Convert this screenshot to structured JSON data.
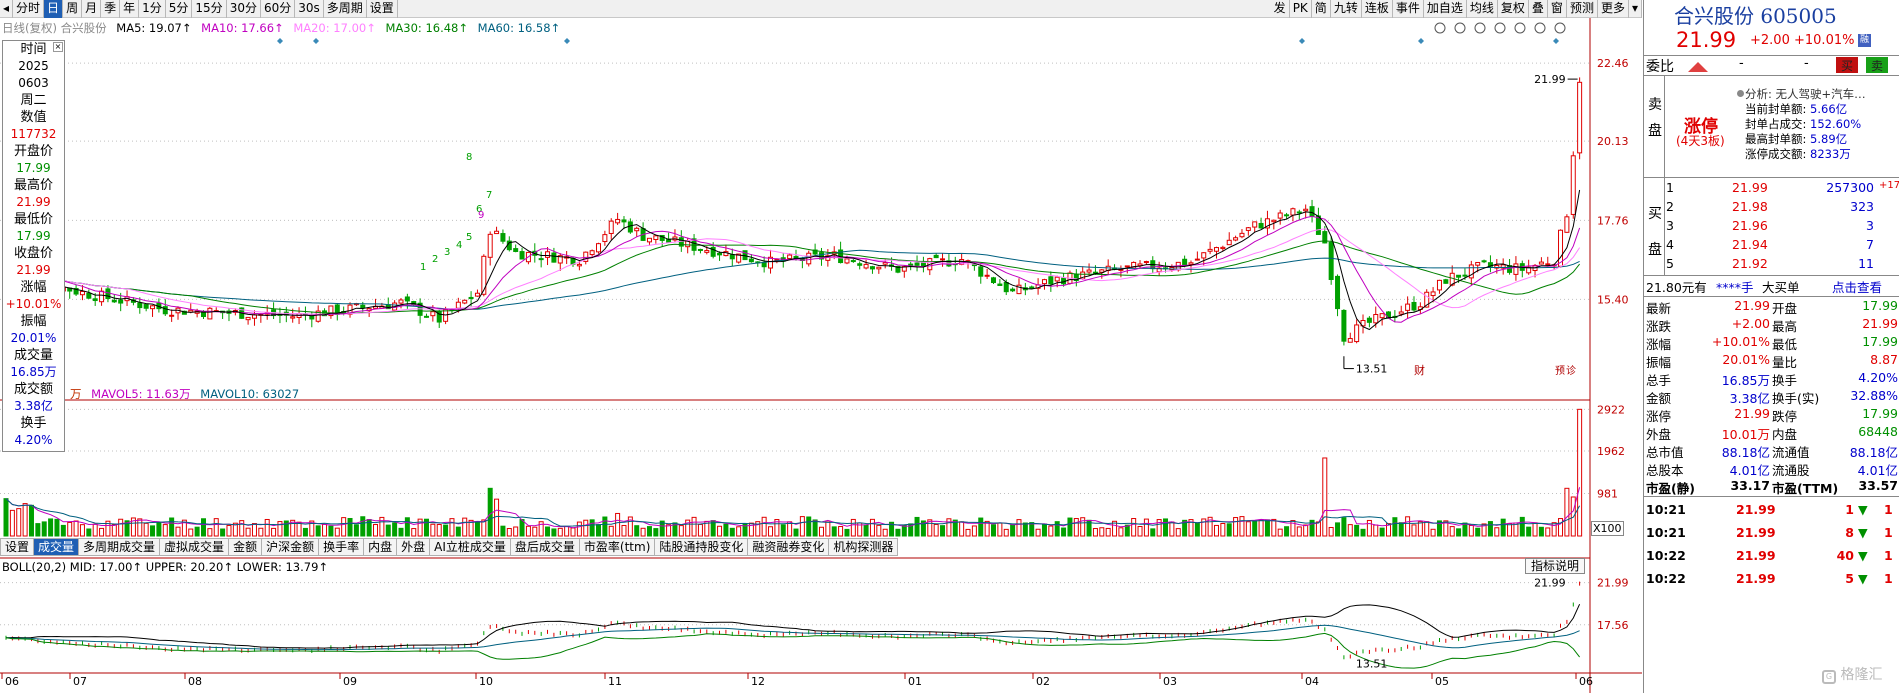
{
  "toolbar": {
    "left": [
      "分时",
      "日",
      "周",
      "月",
      "季",
      "年",
      "1分",
      "5分",
      "15分",
      "30分",
      "60分",
      "30s",
      "多周期",
      "设置"
    ],
    "active": "日",
    "right": [
      "发",
      "PK",
      "简",
      "九转",
      "连板",
      "事件",
      "加自选",
      "均线",
      "复权",
      "叠",
      "窗",
      "预测",
      "更多"
    ]
  },
  "legend_price": {
    "prefix": "日线(复权)  合兴股份",
    "ma5": "MA5: 19.07↑",
    "ma10": "MA10: 17.66↑",
    "ma20": "MA20: 17.00↑",
    "ma30": "MA30: 16.48↑",
    "ma60": "MA60: 16.58↑",
    "colors": {
      "ma5": "#000000",
      "ma10": "#c000c0",
      "ma20": "#ff80ff",
      "ma30": "#008000",
      "ma60": "#006080"
    }
  },
  "legend_vol": {
    "unit": "万",
    "mavol5": "MAVOL5: 11.63万",
    "mavol10": "MAVOL10: 63027"
  },
  "legend_boll": "BOLL(20,2) MID: 17.00↑ UPPER: 20.20↑ LOWER: 13.79↑",
  "popup": {
    "labels": [
      "时间",
      "数值",
      "开盘价",
      "最高价",
      "最低价",
      "收盘价",
      "涨幅",
      "振幅",
      "成交量",
      "成交额",
      "换手"
    ],
    "time_year": "2025",
    "time_md": "0603",
    "time_wd": "周二",
    "value": "117732",
    "open": "17.99",
    "high": "21.99",
    "low": "17.99",
    "close": "21.99",
    "change": "+10.01%",
    "amplitude": "20.01%",
    "volume": "16.85万",
    "amount": "3.38亿",
    "turnover": "4.20%"
  },
  "price_axis": [
    "22.46",
    "20.13",
    "17.76",
    "15.40"
  ],
  "vol_axis": [
    "2922",
    "1962",
    "981"
  ],
  "boll_axis": [
    "21.99",
    "17.56"
  ],
  "annotations": {
    "high": "21.99",
    "low": "13.51",
    "boll_high": "21.99",
    "boll_low": "13.51"
  },
  "x_axis": [
    "06",
    "07",
    "08",
    "09",
    "10",
    "11",
    "12",
    "01",
    "02",
    "03",
    "04",
    "05",
    "06"
  ],
  "markers": {
    "cai": "财",
    "yu": "预",
    "zhen": "诊"
  },
  "td_labels": [
    {
      "t": "1",
      "c": "g"
    },
    {
      "t": "2",
      "c": "g"
    },
    {
      "t": "3",
      "c": "g"
    },
    {
      "t": "4",
      "c": "g"
    },
    {
      "t": "5",
      "c": "g"
    },
    {
      "t": "6",
      "c": "g"
    },
    {
      "t": "7",
      "c": "g"
    },
    {
      "t": "8",
      "c": "g"
    },
    {
      "t": "9",
      "c": "m"
    }
  ],
  "x100": "X100",
  "boll_help": "指标说明",
  "indicator_tabs": [
    "设置",
    "成交量",
    "多周期成交量",
    "虚拟成交量",
    "金额",
    "沪深金额",
    "换手率",
    "内盘",
    "外盘",
    "AI立桩成交量",
    "盘后成交量",
    "市盈率(ttm)",
    "陆股通持股变化",
    "融资融券变化",
    "机构探测器"
  ],
  "indicator_active": "成交量",
  "stock": {
    "name": "合兴股份",
    "code": "605005",
    "price": "21.99",
    "change": "+2.00",
    "pct": "+10.01%",
    "hk_badge": "融"
  },
  "weibi": {
    "label": "委比",
    "v1": "-",
    "v2": "-",
    "sell_btn": "买",
    "buy_btn": "卖"
  },
  "limit": {
    "sell_label": "卖盘",
    "title": "涨停",
    "sub": "(4天3板)",
    "analysis": "分析: 无人驾驶+汽车…",
    "items": [
      {
        "k": "当前封单额:",
        "v": "5.66亿"
      },
      {
        "k": "封单占成交:",
        "v": "152.60%"
      },
      {
        "k": "最高封单额:",
        "v": "5.89亿"
      },
      {
        "k": "涨停成交额:",
        "v": "8233万"
      }
    ]
  },
  "bids": {
    "label": "买盘",
    "rows": [
      {
        "lv": "1",
        "p": "21.99",
        "v": "257300",
        "d": "+17"
      },
      {
        "lv": "2",
        "p": "21.98",
        "v": "323",
        "d": ""
      },
      {
        "lv": "3",
        "p": "21.96",
        "v": "3",
        "d": ""
      },
      {
        "lv": "4",
        "p": "21.94",
        "v": "7",
        "d": ""
      },
      {
        "lv": "5",
        "p": "21.92",
        "v": "11",
        "d": ""
      }
    ]
  },
  "bar2": {
    "a": "21.80元有",
    "b": "****手",
    "c": "大买单",
    "d": "点击查看"
  },
  "quote": [
    {
      "k1": "最新",
      "v1": "21.99",
      "c1": "r",
      "k2": "开盘",
      "v2": "17.99",
      "c2": "g"
    },
    {
      "k1": "涨跌",
      "v1": "+2.00",
      "c1": "r",
      "k2": "最高",
      "v2": "21.99",
      "c2": "r"
    },
    {
      "k1": "涨幅",
      "v1": "+10.01%",
      "c1": "r",
      "k2": "最低",
      "v2": "17.99",
      "c2": "g"
    },
    {
      "k1": "振幅",
      "v1": "20.01%",
      "c1": "r",
      "k2": "量比",
      "v2": "8.87",
      "c2": "r"
    },
    {
      "k1": "总手",
      "v1": "16.85万",
      "c1": "b",
      "k2": "换手",
      "v2": "4.20%",
      "c2": "b"
    },
    {
      "k1": "金额",
      "v1": "3.38亿",
      "c1": "b",
      "k2": "换手(实)",
      "v2": "32.88%",
      "c2": "b"
    },
    {
      "k1": "涨停",
      "v1": "21.99",
      "c1": "r",
      "k2": "跌停",
      "v2": "17.99",
      "c2": "g"
    },
    {
      "k1": "外盘",
      "v1": "10.01万",
      "c1": "r",
      "k2": "内盘",
      "v2": "68448",
      "c2": "g"
    },
    {
      "k1": "总市值",
      "v1": "88.18亿",
      "c1": "b",
      "k2": "流通值",
      "v2": "88.18亿",
      "c2": "b"
    },
    {
      "k1": "总股本",
      "v1": "4.01亿",
      "c1": "b",
      "k2": "流通股",
      "v2": "4.01亿",
      "c2": "b"
    },
    {
      "k1": "市盈(静)",
      "v1": "33.17",
      "c1": "k",
      "k2": "市盈(TTM)",
      "v2": "33.57",
      "c2": "k"
    }
  ],
  "ticks": [
    {
      "t": "10:21",
      "p": "21.99",
      "v": "1",
      "n": "1"
    },
    {
      "t": "10:21",
      "p": "21.99",
      "v": "8",
      "n": "1"
    },
    {
      "t": "10:22",
      "p": "21.99",
      "v": "40",
      "n": "1"
    },
    {
      "t": "10:22",
      "p": "21.99",
      "v": "5",
      "n": "1"
    }
  ],
  "watermark": "格隆汇",
  "colors": {
    "up": "#e00000",
    "down": "#00a000",
    "blue": "#0000cc",
    "toolbar_active": "#1f5fb4"
  }
}
